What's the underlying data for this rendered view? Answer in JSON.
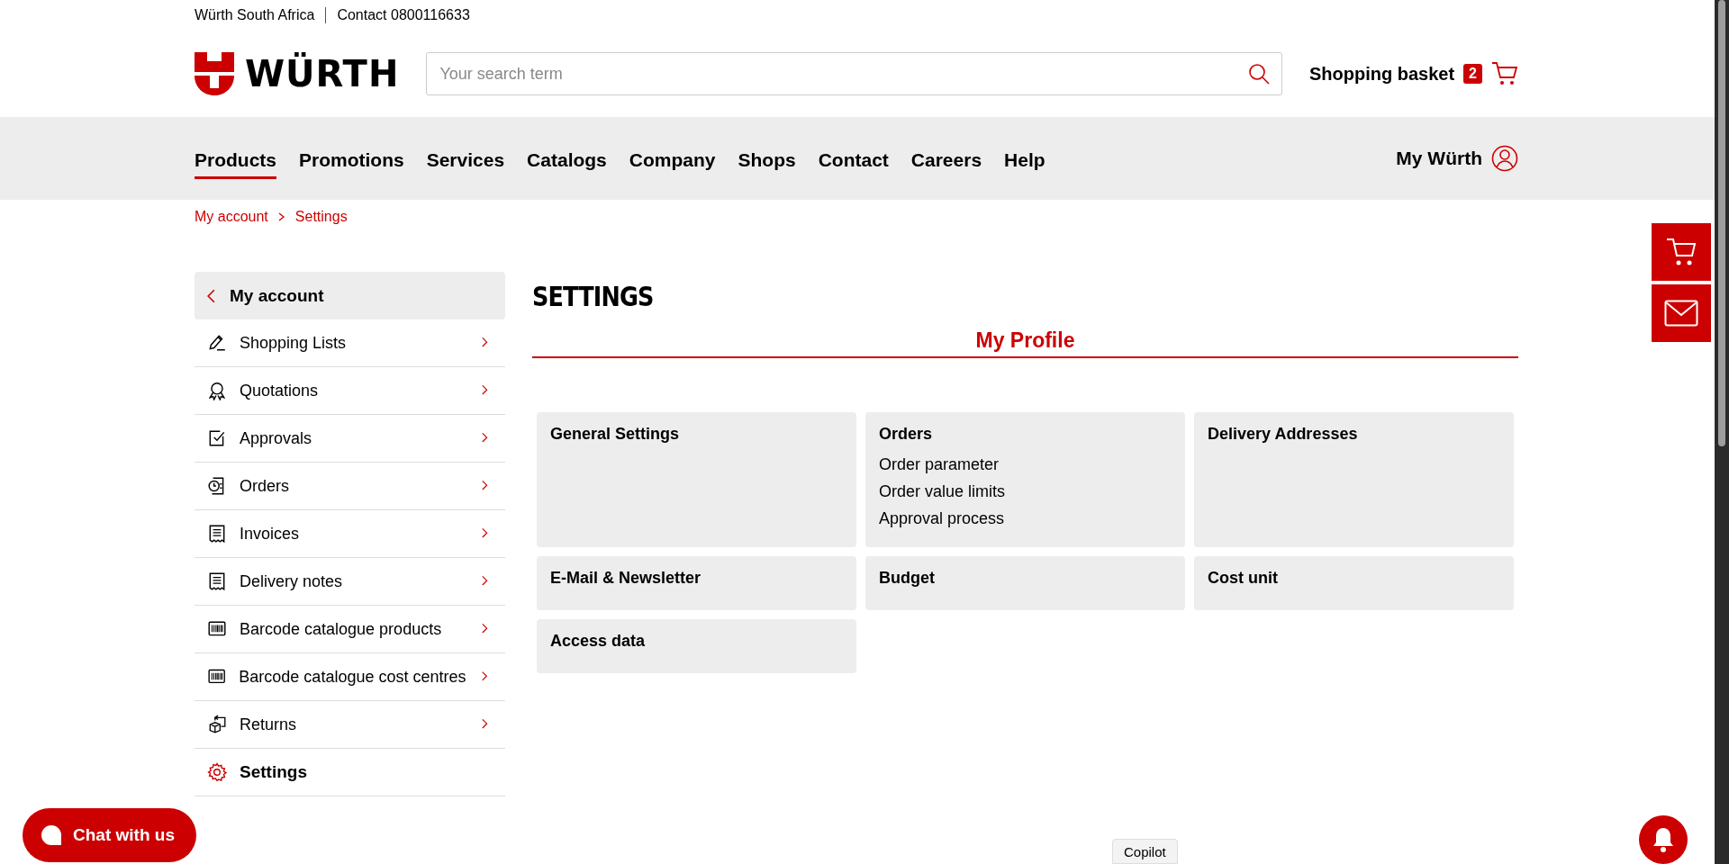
{
  "top_bar": {
    "company": "Würth South Africa",
    "contact": "Contact 0800116633"
  },
  "header": {
    "logo": "WÜRTH",
    "search": {
      "placeholder": "Your search term"
    },
    "basket": {
      "label": "Shopping basket",
      "count": "2"
    }
  },
  "nav": {
    "items": [
      {
        "label": "Products",
        "selected": true
      },
      {
        "label": "Promotions",
        "selected": false
      },
      {
        "label": "Services",
        "selected": false
      },
      {
        "label": "Catalogs",
        "selected": false
      },
      {
        "label": "Company",
        "selected": false
      },
      {
        "label": "Shops",
        "selected": false
      },
      {
        "label": "Contact",
        "selected": false
      },
      {
        "label": "Careers",
        "selected": false
      },
      {
        "label": "Help",
        "selected": false
      }
    ],
    "account": "My Würth"
  },
  "breadcrumb": [
    "My account",
    "Settings"
  ],
  "sidebar": {
    "back": "My account",
    "items": [
      {
        "label": "Shopping Lists",
        "selected": false
      },
      {
        "label": "Quotations",
        "selected": false
      },
      {
        "label": "Approvals",
        "selected": false
      },
      {
        "label": "Orders",
        "selected": false
      },
      {
        "label": "Invoices",
        "selected": false
      },
      {
        "label": "Delivery notes",
        "selected": false
      },
      {
        "label": "Barcode catalogue products",
        "selected": false
      },
      {
        "label": "Barcode catalogue cost centres",
        "selected": false
      },
      {
        "label": "Returns",
        "selected": false
      },
      {
        "label": "Settings",
        "selected": true
      }
    ]
  },
  "main": {
    "title": "SETTINGS",
    "tab": "My Profile",
    "cards": [
      {
        "title": "General Settings"
      },
      {
        "title": "Orders",
        "links": [
          "Order parameter",
          "Order value limits",
          "Approval process"
        ]
      },
      {
        "title": "Delivery Addresses"
      },
      {
        "title": "E-Mail & Newsletter"
      },
      {
        "title": "Budget"
      },
      {
        "title": "Cost unit"
      },
      {
        "title": "Access data"
      }
    ]
  },
  "chat": {
    "label": "Chat with us"
  },
  "copilot": "Copilot"
}
